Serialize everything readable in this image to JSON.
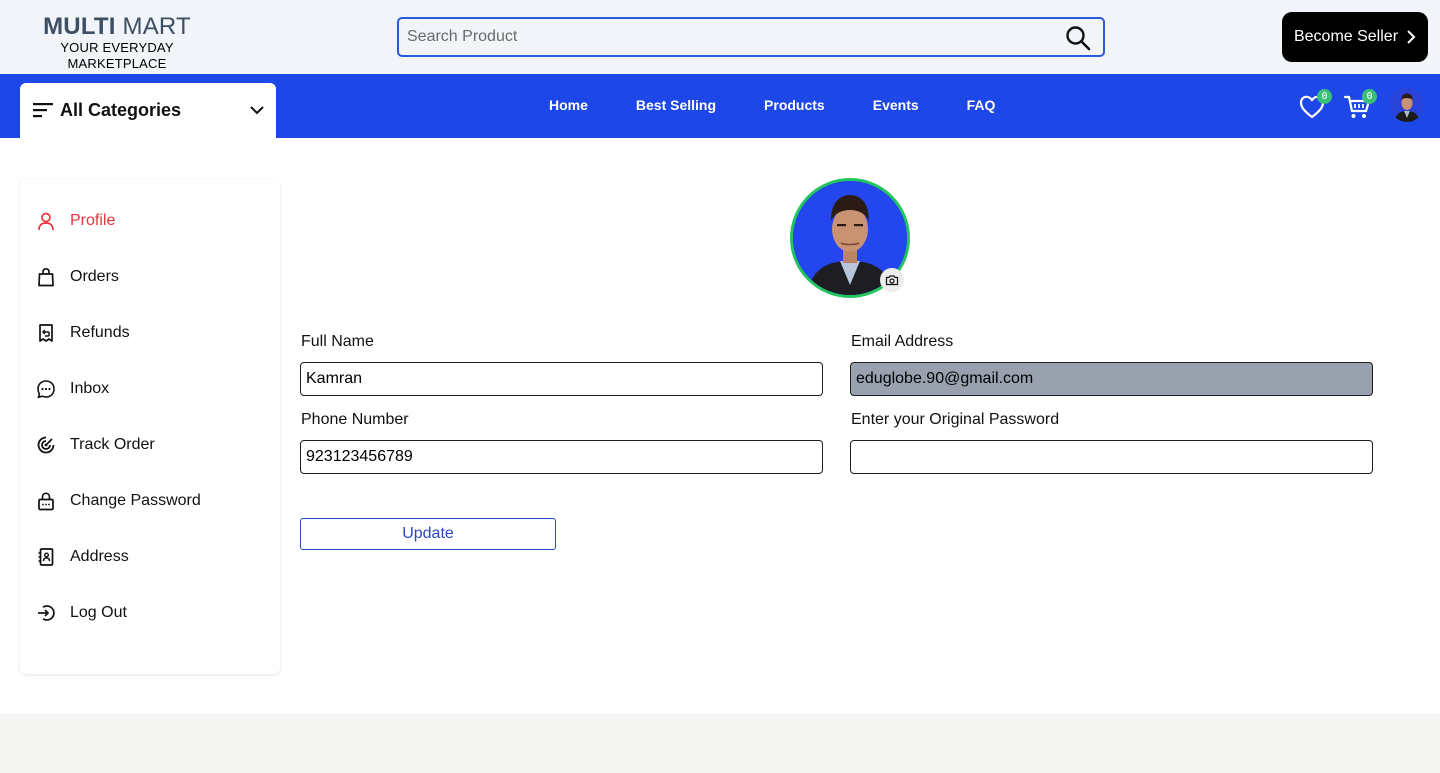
{
  "header": {
    "logo_bold": "MULTI",
    "logo_light": " MART",
    "tagline": "YOUR EVERYDAY MARKETPLACE",
    "search_placeholder": "Search Product",
    "become_seller": "Become Seller"
  },
  "navbar": {
    "categories_label": "All Categories",
    "links": [
      "Home",
      "Best Selling",
      "Products",
      "Events",
      "FAQ"
    ],
    "wishlist_count": "0",
    "cart_count": "0"
  },
  "sidebar": {
    "items": [
      {
        "label": "Profile",
        "icon": "person-icon",
        "active": true
      },
      {
        "label": "Orders",
        "icon": "shopping-bag-icon"
      },
      {
        "label": "Refunds",
        "icon": "refund-icon"
      },
      {
        "label": "Inbox",
        "icon": "chat-icon"
      },
      {
        "label": "Track Order",
        "icon": "track-icon"
      },
      {
        "label": "Change Password",
        "icon": "lock-icon"
      },
      {
        "label": "Address",
        "icon": "address-book-icon"
      },
      {
        "label": "Log Out",
        "icon": "logout-icon"
      }
    ]
  },
  "profile": {
    "full_name_label": "Full Name",
    "full_name_value": "Kamran",
    "email_label": "Email Address",
    "email_value": "eduglobe.90@gmail.com",
    "phone_label": "Phone Number",
    "phone_value": "923123456789",
    "password_label": "Enter your Original Password",
    "password_value": "",
    "update_label": "Update"
  },
  "colors": {
    "nav_blue": "#1d47e6",
    "active_red": "#e9333b",
    "badge_green": "#3bc177",
    "avatar_ring": "#22c55e"
  }
}
